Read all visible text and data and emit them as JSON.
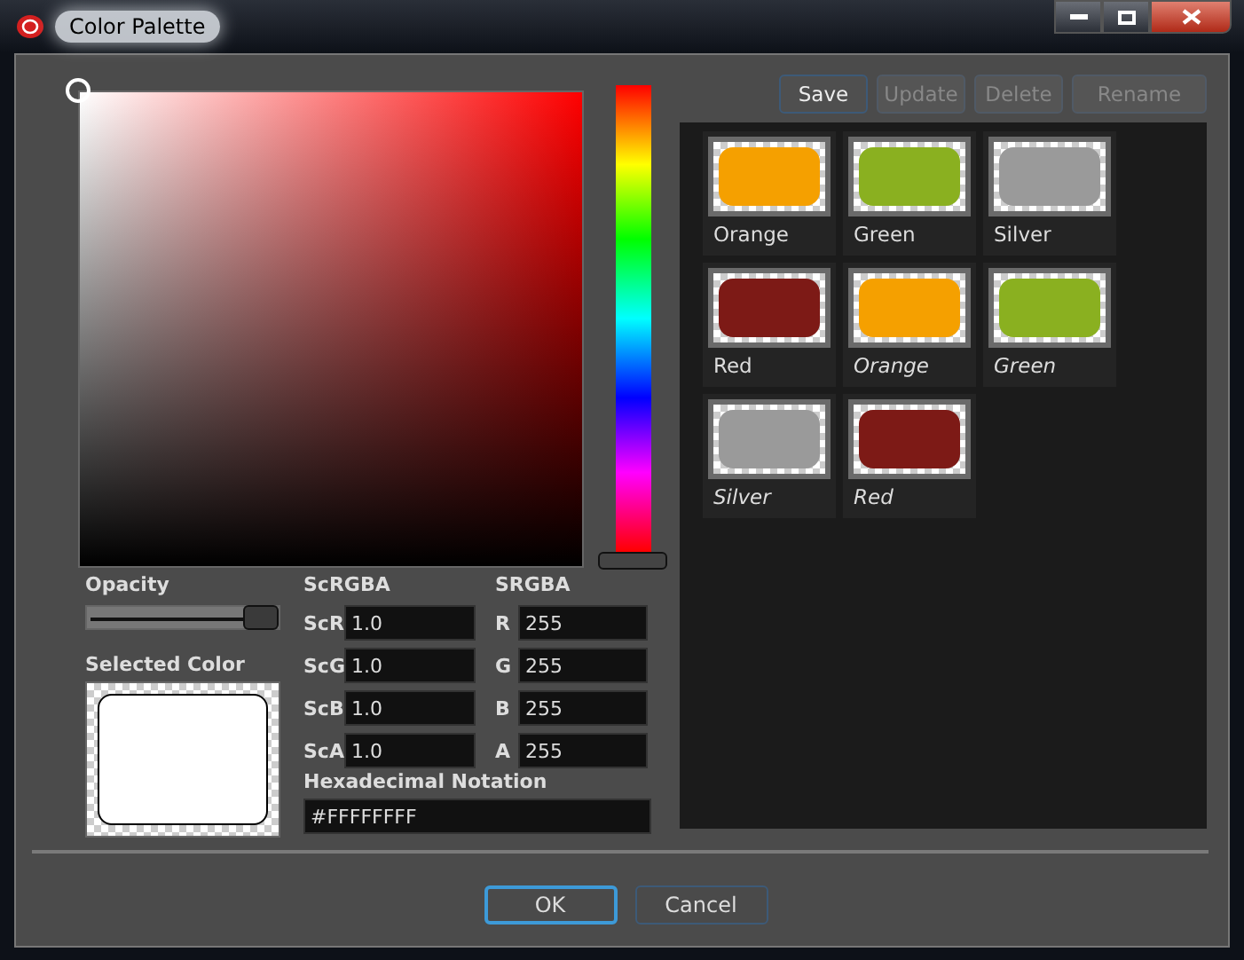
{
  "window": {
    "title": "Color Palette"
  },
  "opacity": {
    "label": "Opacity",
    "level": 1
  },
  "selected_color": {
    "label": "Selected Color"
  },
  "scrgba": {
    "heading": "ScRGBA",
    "fields": [
      {
        "label": "ScR",
        "value": "1.0"
      },
      {
        "label": "ScG",
        "value": "1.0"
      },
      {
        "label": "ScB",
        "value": "1.0"
      },
      {
        "label": "ScA",
        "value": "1.0"
      }
    ]
  },
  "srgba": {
    "heading": "SRGBA",
    "fields": [
      {
        "label": "R",
        "value": "255"
      },
      {
        "label": "G",
        "value": "255"
      },
      {
        "label": "B",
        "value": "255"
      },
      {
        "label": "A",
        "value": "255"
      }
    ]
  },
  "hex": {
    "label": "Hexadecimal Notation",
    "value": "#FFFFFFFF"
  },
  "palette_buttons": [
    {
      "label": "Save",
      "disabled": false
    },
    {
      "label": "Update",
      "disabled": true
    },
    {
      "label": "Delete",
      "disabled": true
    },
    {
      "label": "Rename",
      "disabled": true
    }
  ],
  "swatches": [
    {
      "name": "Orange",
      "color": "#f5a000",
      "italic": false
    },
    {
      "name": "Green",
      "color": "#8ab020",
      "italic": false
    },
    {
      "name": "Silver",
      "color": "#9a9a9a",
      "italic": false
    },
    {
      "name": "Red",
      "color": "#7d1a16",
      "italic": false
    },
    {
      "name": "Orange",
      "color": "#f5a000",
      "italic": true
    },
    {
      "name": "Green",
      "color": "#8ab020",
      "italic": true
    },
    {
      "name": "Silver",
      "color": "#9a9a9a",
      "italic": true
    },
    {
      "name": "Red",
      "color": "#7d1a16",
      "italic": true
    }
  ],
  "buttons": [
    {
      "label": "OK",
      "default": true
    },
    {
      "label": "Cancel",
      "default": false
    }
  ]
}
